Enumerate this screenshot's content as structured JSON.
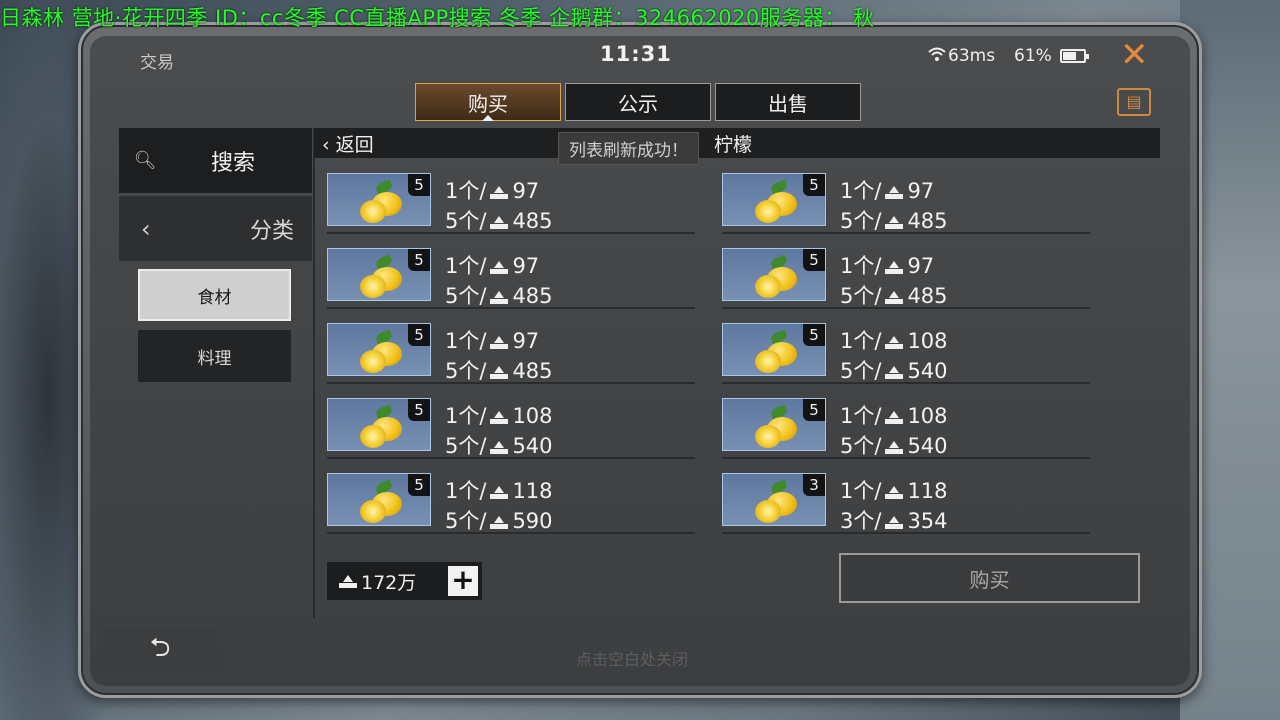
{
  "stream_ticker": "日森林 营地·花开四季  ID：cc冬季   CC直播APP搜索 冬季  企鹅群：324662020服务器： 秋",
  "status": {
    "title": "交易",
    "time": "11:31",
    "ping": "63ms",
    "battery": "61%",
    "battery_level": 0.61
  },
  "tabs": [
    {
      "label": "购买",
      "active": true
    },
    {
      "label": "公示",
      "active": false
    },
    {
      "label": "出售",
      "active": false
    }
  ],
  "sidebar": {
    "search_label": "搜索",
    "category_label": "分类",
    "subcategories": [
      {
        "label": "食材",
        "active": true
      },
      {
        "label": "料理",
        "active": false
      }
    ]
  },
  "list": {
    "back_label": "返回",
    "item_name": "柠檬",
    "toast": "列表刷新成功！",
    "listings": [
      {
        "qty": "5",
        "price_line1": "1个/",
        "unit_price": "97",
        "price_line2": "5个/",
        "total_price": "485"
      },
      {
        "qty": "5",
        "price_line1": "1个/",
        "unit_price": "97",
        "price_line2": "5个/",
        "total_price": "485"
      },
      {
        "qty": "5",
        "price_line1": "1个/",
        "unit_price": "97",
        "price_line2": "5个/",
        "total_price": "485"
      },
      {
        "qty": "5",
        "price_line1": "1个/",
        "unit_price": "97",
        "price_line2": "5个/",
        "total_price": "485"
      },
      {
        "qty": "5",
        "price_line1": "1个/",
        "unit_price": "97",
        "price_line2": "5个/",
        "total_price": "485"
      },
      {
        "qty": "5",
        "price_line1": "1个/",
        "unit_price": "108",
        "price_line2": "5个/",
        "total_price": "540"
      },
      {
        "qty": "5",
        "price_line1": "1个/",
        "unit_price": "108",
        "price_line2": "5个/",
        "total_price": "540"
      },
      {
        "qty": "5",
        "price_line1": "1个/",
        "unit_price": "108",
        "price_line2": "5个/",
        "total_price": "540"
      },
      {
        "qty": "5",
        "price_line1": "1个/",
        "unit_price": "118",
        "price_line2": "5个/",
        "total_price": "590"
      },
      {
        "qty": "3",
        "price_line1": "1个/",
        "unit_price": "118",
        "price_line2": "3个/",
        "total_price": "354"
      }
    ]
  },
  "balance": "172万",
  "buy_button": "购买",
  "close_hint": "点击空白处关闭",
  "colors": {
    "accent": "#e08a3a",
    "ticker": "#22ff22"
  }
}
